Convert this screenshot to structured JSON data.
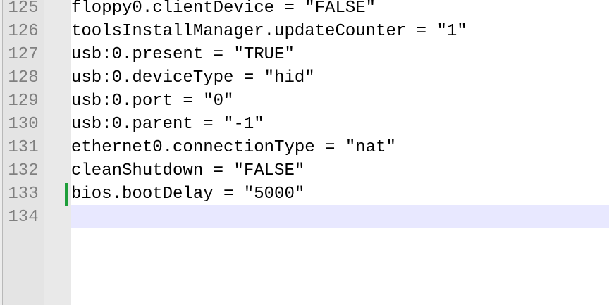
{
  "editor": {
    "lines": [
      {
        "number": "125",
        "text": "floppy0.clientDevice = \"FALSE\""
      },
      {
        "number": "126",
        "text": "toolsInstallManager.updateCounter = \"1\""
      },
      {
        "number": "127",
        "text": "usb:0.present = \"TRUE\""
      },
      {
        "number": "128",
        "text": "usb:0.deviceType = \"hid\""
      },
      {
        "number": "129",
        "text": "usb:0.port = \"0\""
      },
      {
        "number": "130",
        "text": "usb:0.parent = \"-1\""
      },
      {
        "number": "131",
        "text": "ethernet0.connectionType = \"nat\""
      },
      {
        "number": "132",
        "text": "cleanShutdown = \"FALSE\""
      },
      {
        "number": "133",
        "text": "bios.bootDelay = \"5000\""
      },
      {
        "number": "134",
        "text": ""
      }
    ],
    "current_line": "134",
    "changed_line": "133",
    "colors": {
      "gutter_bg": "#e4e4e4",
      "line_number": "#808080",
      "current_line_bg": "#e8e8ff",
      "change_marker": "#1e9e3a",
      "text": "#000000"
    }
  }
}
